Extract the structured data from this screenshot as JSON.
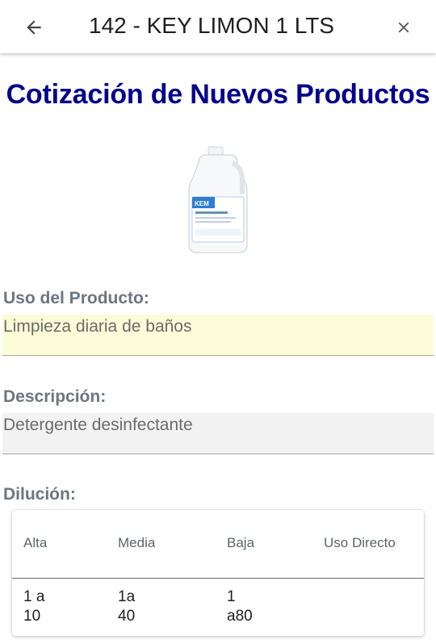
{
  "header": {
    "title": "142 - KEY LIMON 1 LTS",
    "back_icon": "arrow-left-icon",
    "close_icon": "close-icon"
  },
  "main": {
    "heading": "Cotización de Nuevos Productos",
    "product_image": "white-gallon-jug",
    "product_label_text": "KEM",
    "uso": {
      "label": "Uso del Producto:",
      "value": "Limpieza diaria de baños"
    },
    "descripcion": {
      "label": "Descripción:",
      "value": "Detergente desinfectante"
    },
    "dilucion": {
      "label": "Dilución:",
      "columns": [
        "Alta",
        "Media",
        "Baja",
        "Uso Directo"
      ],
      "row": [
        [
          "1 a",
          "10"
        ],
        [
          "1a",
          "40"
        ],
        [
          "1",
          "a80"
        ],
        [
          "",
          ""
        ]
      ]
    }
  },
  "colors": {
    "heading": "#00008b",
    "uso_bg": "#fcfcd8",
    "desc_bg": "#f2f2f2",
    "label": "#6b7680"
  }
}
